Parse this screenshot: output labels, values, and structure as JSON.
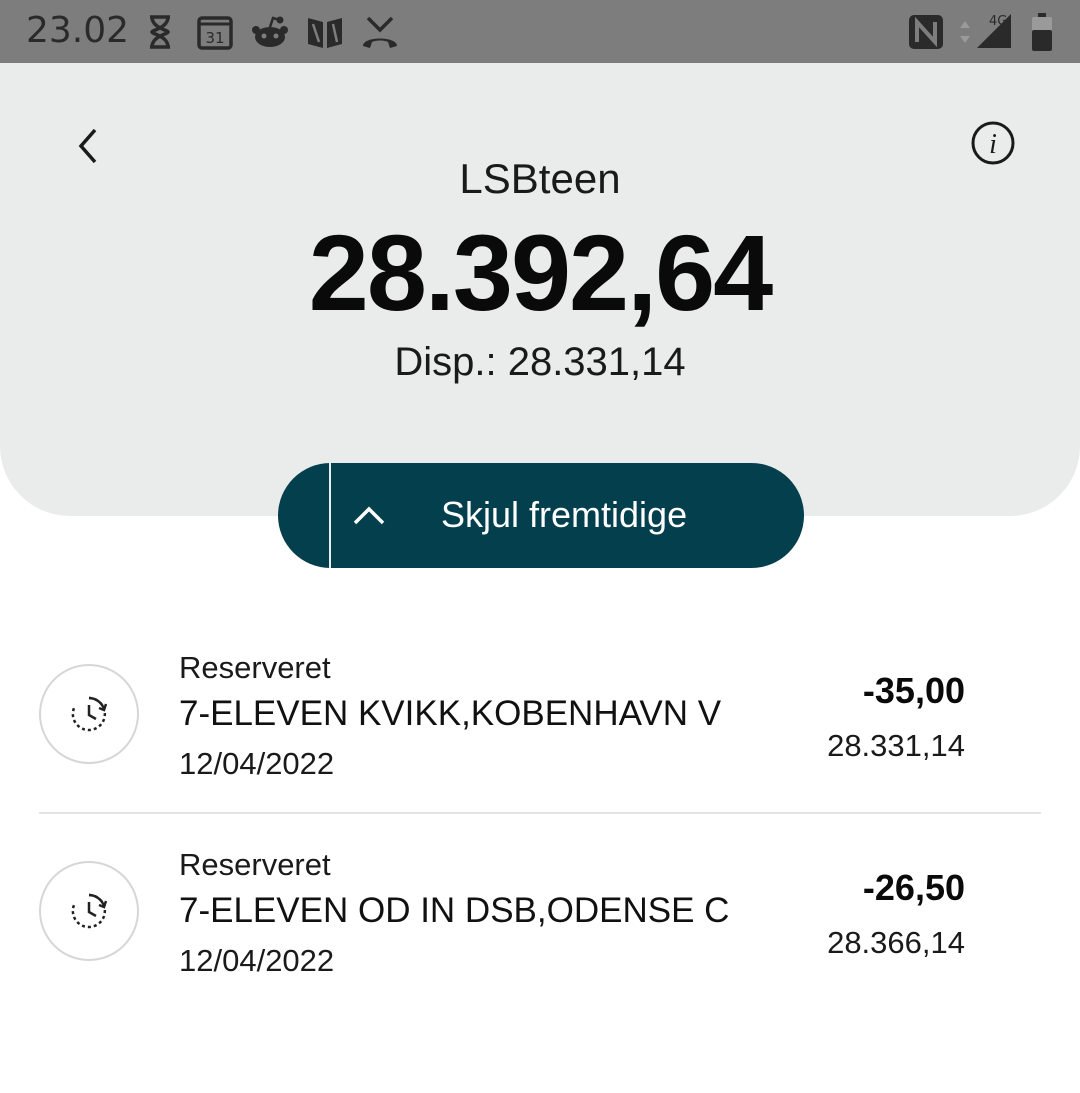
{
  "status_bar": {
    "time": "23.02",
    "network": "4G",
    "icons": [
      "hourglass-icon",
      "calendar-icon",
      "reddit-icon",
      "book-icon",
      "missed-call-icon",
      "nfc-icon",
      "signal-icon",
      "battery-icon"
    ],
    "calendar_day": "31",
    "color": "#7d7d7d"
  },
  "header": {
    "account_name": "LSBteen",
    "balance": "28.392,64",
    "available": "Disp.: 28.331,14",
    "background": "#e9eceb"
  },
  "toggle": {
    "label": "Skjul fremtidige",
    "color": "#033f4c"
  },
  "transactions": [
    {
      "status": "Reserveret",
      "name": "7-ELEVEN KVIKK,KOBENHAVN V",
      "date": "12/04/2022",
      "amount": "-35,00",
      "balance": "28.331,14",
      "icon": "pending-clock-icon"
    },
    {
      "status": "Reserveret",
      "name": "7-ELEVEN OD IN DSB,ODENSE C",
      "date": "12/04/2022",
      "amount": "-26,50",
      "balance": "28.366,14",
      "icon": "pending-clock-icon"
    }
  ]
}
